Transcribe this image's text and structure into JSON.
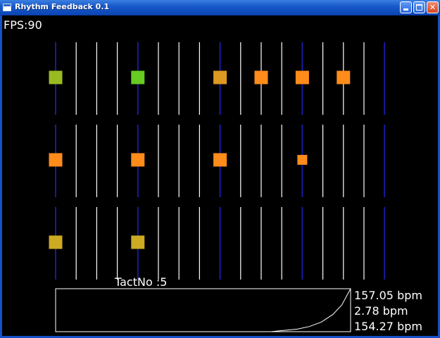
{
  "window": {
    "title": "Rhythm Feedback 0.1"
  },
  "hud": {
    "fps_label": "FPS:90",
    "tact_label": "TactNo :5"
  },
  "bpm": [
    "157.05 bpm",
    "2.78 bpm",
    "154.27 bpm"
  ],
  "colors": {
    "beat_line": "#1a1aa0",
    "sub_line": "#ffffff",
    "note_orange": "#ff8c1a",
    "note_green": "#66cc22",
    "note_yellow_green": "#99bb22",
    "note_amber": "#dd9922",
    "note_olive": "#ccaa22"
  },
  "tracks": [
    {
      "notes": [
        {
          "beat": 0,
          "color": "#99bb22",
          "size": "large"
        },
        {
          "beat": 4,
          "color": "#66cc22",
          "size": "large"
        },
        {
          "beat": 8,
          "color": "#dd9922",
          "size": "large"
        },
        {
          "beat": 10,
          "color": "#ff8c1a",
          "size": "large"
        },
        {
          "beat": 12,
          "color": "#ff8c1a",
          "size": "large"
        },
        {
          "beat": 14,
          "color": "#ff8c1a",
          "size": "large"
        }
      ]
    },
    {
      "notes": [
        {
          "beat": 0,
          "color": "#ff8c1a",
          "size": "large"
        },
        {
          "beat": 4,
          "color": "#ff8c1a",
          "size": "large"
        },
        {
          "beat": 8,
          "color": "#ff8c1a",
          "size": "large"
        },
        {
          "beat": 12,
          "color": "#ff8c1a",
          "size": "small"
        }
      ]
    },
    {
      "notes": [
        {
          "beat": 0,
          "color": "#ccaa22",
          "size": "large"
        },
        {
          "beat": 4,
          "color": "#ccaa22",
          "size": "large"
        }
      ]
    }
  ],
  "lines_per_track": 17,
  "graph": {
    "curve": [
      [
        0.0,
        0.0
      ],
      [
        0.73,
        0.0
      ],
      [
        0.76,
        0.02
      ],
      [
        0.82,
        0.06
      ],
      [
        0.86,
        0.12
      ],
      [
        0.9,
        0.22
      ],
      [
        0.94,
        0.4
      ],
      [
        0.97,
        0.62
      ],
      [
        1.0,
        1.0
      ]
    ]
  }
}
